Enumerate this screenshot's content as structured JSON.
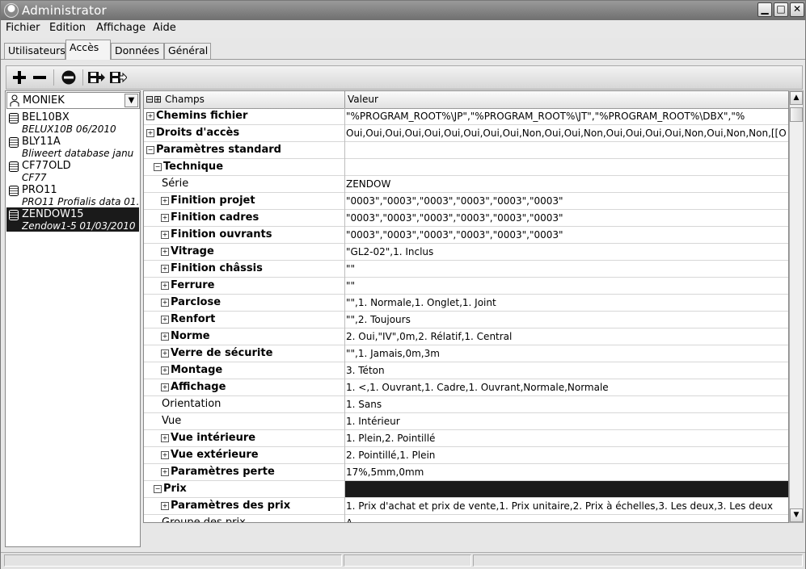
{
  "window": {
    "title": "Administrator"
  },
  "menu": [
    "Fichier",
    "Edition",
    "Affichage",
    "Aide"
  ],
  "tabs": [
    "Utilisateurs",
    "Accès",
    "Données",
    "Général"
  ],
  "active_tab": "Accès",
  "toolbar": {
    "icons": [
      "add-icon",
      "remove-icon",
      "delete-icon",
      "export-icon",
      "import-icon"
    ]
  },
  "user_select": {
    "value": "MONIEK"
  },
  "databases": [
    {
      "name": "BEL10BX",
      "desc": "BELUX10B 06/2010"
    },
    {
      "name": "BLY11A",
      "desc": "Bliweert database janu"
    },
    {
      "name": "CF77OLD",
      "desc": "CF77"
    },
    {
      "name": "PRO11",
      "desc": "PRO11 Profialis data 01."
    },
    {
      "name": "ZENDOW15",
      "desc": "Zendow1-5 01/03/2010"
    }
  ],
  "selected_database": "ZENDOW15",
  "grid": {
    "col_champs": "Champs",
    "col_valeur": "Valeur",
    "rows": [
      {
        "label": "Chemins fichier",
        "value": "\"%PROGRAM_ROOT%\\JP\",\"%PROGRAM_ROOT%\\JT\",\"%PROGRAM_ROOT%\\DBX\",\"%",
        "level": 0,
        "expander": "+",
        "bold": true
      },
      {
        "label": "Droits d'accès",
        "value": "Oui,Oui,Oui,Oui,Oui,Oui,Oui,Oui,Oui,Non,Oui,Oui,Non,Oui,Oui,Oui,Oui,Non,Oui,Non,Non,[[O",
        "level": 0,
        "expander": "+",
        "bold": true
      },
      {
        "label": "Paramètres standard",
        "value": "",
        "level": 0,
        "expander": "-",
        "bold": true
      },
      {
        "label": "Technique",
        "value": "",
        "level": 1,
        "expander": "-",
        "bold": true
      },
      {
        "label": "Série",
        "value": "ZENDOW",
        "level": 2,
        "expander": "",
        "bold": false
      },
      {
        "label": "Finition projet",
        "value": "\"0003\",\"0003\",\"0003\",\"0003\",\"0003\",\"0003\"",
        "level": 2,
        "expander": "+",
        "bold": true
      },
      {
        "label": "Finition cadres",
        "value": "\"0003\",\"0003\",\"0003\",\"0003\",\"0003\",\"0003\"",
        "level": 2,
        "expander": "+",
        "bold": true
      },
      {
        "label": "Finition ouvrants",
        "value": "\"0003\",\"0003\",\"0003\",\"0003\",\"0003\",\"0003\"",
        "level": 2,
        "expander": "+",
        "bold": true
      },
      {
        "label": "Vitrage",
        "value": "\"GL2-02\",1. Inclus",
        "level": 2,
        "expander": "+",
        "bold": true
      },
      {
        "label": "Finition châssis",
        "value": "\"\"",
        "level": 2,
        "expander": "+",
        "bold": true
      },
      {
        "label": "Ferrure",
        "value": "\"\"",
        "level": 2,
        "expander": "+",
        "bold": true
      },
      {
        "label": "Parclose",
        "value": "\"\",1. Normale,1. Onglet,1. Joint",
        "level": 2,
        "expander": "+",
        "bold": true
      },
      {
        "label": "Renfort",
        "value": "\"\",2. Toujours",
        "level": 2,
        "expander": "+",
        "bold": true
      },
      {
        "label": "Norme",
        "value": "2. Oui,\"IV\",0m,2. Rélatif,1. Central",
        "level": 2,
        "expander": "+",
        "bold": true
      },
      {
        "label": "Verre de sécurite",
        "value": "\"\",1. Jamais,0m,3m",
        "level": 2,
        "expander": "+",
        "bold": true
      },
      {
        "label": "Montage",
        "value": "3. Téton",
        "level": 2,
        "expander": "+",
        "bold": true
      },
      {
        "label": "Affichage",
        "value": "1. <,1. Ouvrant,1. Cadre,1. Ouvrant,Normale,Normale",
        "level": 2,
        "expander": "+",
        "bold": true
      },
      {
        "label": "Orientation",
        "value": "1. Sans",
        "level": 2,
        "expander": "",
        "bold": false
      },
      {
        "label": "Vue",
        "value": "1. Intérieur",
        "level": 2,
        "expander": "",
        "bold": false
      },
      {
        "label": "Vue intérieure",
        "value": "1. Plein,2. Pointillé",
        "level": 2,
        "expander": "+",
        "bold": true
      },
      {
        "label": "Vue extérieure",
        "value": "2. Pointillé,1. Plein",
        "level": 2,
        "expander": "+",
        "bold": true
      },
      {
        "label": "Paramètres perte",
        "value": "17%,5mm,0mm",
        "level": 2,
        "expander": "+",
        "bold": true
      },
      {
        "label": "Prix",
        "value": "",
        "level": 1,
        "expander": "-",
        "bold": true,
        "selected": true
      },
      {
        "label": "Paramètres des prix",
        "value": "1. Prix d'achat et prix de vente,1. Prix unitaire,2. Prix à échelles,3. Les deux,3. Les deux",
        "level": 2,
        "expander": "+",
        "bold": true
      },
      {
        "label": "Groupe des prix",
        "value": "A",
        "level": 2,
        "expander": "",
        "bold": false
      }
    ]
  },
  "colors": {
    "titlebar": "#7a7a7a",
    "selection": "#1a1a1a",
    "window_bg": "#e7e7e7"
  }
}
